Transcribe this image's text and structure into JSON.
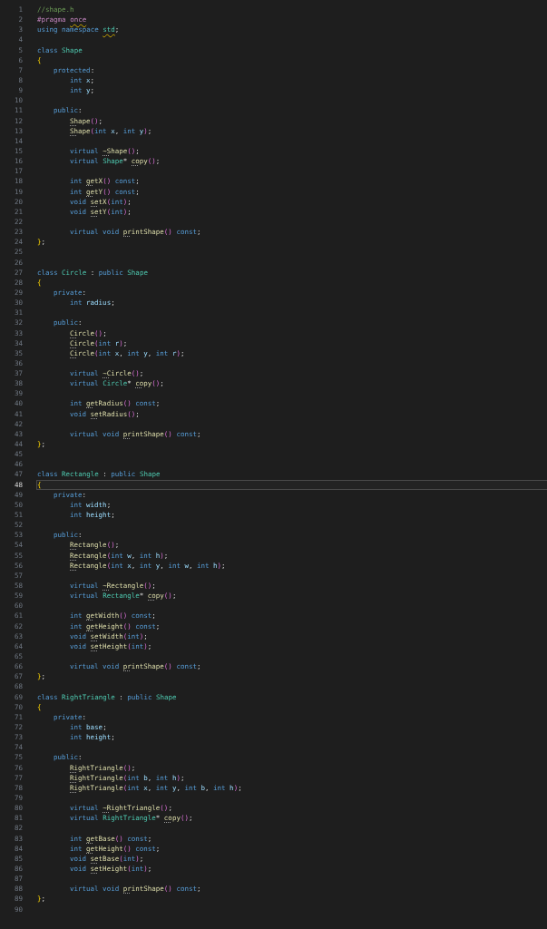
{
  "editor": {
    "lines": [
      {
        "number": "1",
        "current": false,
        "tokens": [
          {
            "text": "//shape.h",
            "kind": "cm"
          }
        ]
      },
      {
        "number": "2",
        "current": false,
        "tokens": [
          {
            "text": "#pragma ",
            "kind": "pp"
          },
          {
            "text": "once",
            "kind": "pp_warn"
          }
        ]
      },
      {
        "number": "3",
        "current": false,
        "tokens": [
          {
            "text": "using namespace ",
            "kind": "kw"
          },
          {
            "text": "std",
            "kind": "type_warn"
          },
          {
            "text": ";",
            "kind": "p"
          }
        ]
      },
      {
        "number": "4",
        "current": false
      },
      {
        "number": "5",
        "current": false,
        "tokens": [
          {
            "text": "class ",
            "kind": "kw"
          },
          {
            "text": "Shape",
            "kind": "type"
          }
        ]
      },
      {
        "number": "6",
        "current": false,
        "tokens": [
          {
            "text": "{",
            "kind": "b1"
          }
        ]
      },
      {
        "number": "7",
        "current": false,
        "kind": "access",
        "tokens": [
          {
            "text": "protected",
            "kind": "kw"
          },
          {
            "text": ":",
            "kind": "p"
          }
        ]
      },
      {
        "number": "8",
        "current": false,
        "kind": "member",
        "tokens": [
          {
            "text": "int ",
            "kind": "kw"
          },
          {
            "text": "x",
            "kind": "var"
          },
          {
            "text": ";",
            "kind": "p"
          }
        ]
      },
      {
        "number": "9",
        "current": false,
        "kind": "member",
        "tokens": [
          {
            "text": "int ",
            "kind": "kw"
          },
          {
            "text": "y",
            "kind": "var"
          },
          {
            "text": ";",
            "kind": "p"
          }
        ]
      },
      {
        "number": "10",
        "current": false
      },
      {
        "number": "11",
        "current": false,
        "kind": "access",
        "tokens": [
          {
            "text": "public",
            "kind": "kw"
          },
          {
            "text": ":",
            "kind": "p"
          }
        ]
      },
      {
        "number": "12",
        "current": false,
        "kind": "member",
        "tokens": [
          {
            "text": "Shape",
            "kind": "fn"
          },
          {
            "text": "()",
            "kind": "b2"
          },
          {
            "text": ";",
            "kind": "p"
          }
        ]
      },
      {
        "number": "13",
        "current": false,
        "kind": "member",
        "tokens": [
          {
            "text": "Shape",
            "kind": "fn"
          },
          {
            "text": "(",
            "kind": "b2"
          },
          {
            "text": "int ",
            "kind": "kw"
          },
          {
            "text": "x",
            "kind": "var"
          },
          {
            "text": ", ",
            "kind": "p"
          },
          {
            "text": "int ",
            "kind": "kw"
          },
          {
            "text": "y",
            "kind": "var"
          },
          {
            "text": ")",
            "kind": "b2"
          },
          {
            "text": ";",
            "kind": "p"
          }
        ]
      },
      {
        "number": "14",
        "current": false
      },
      {
        "number": "15",
        "current": false,
        "kind": "member",
        "tokens": [
          {
            "text": "virtual ",
            "kind": "kw"
          },
          {
            "text": "~Shape",
            "kind": "fn"
          },
          {
            "text": "()",
            "kind": "b2"
          },
          {
            "text": ";",
            "kind": "p"
          }
        ]
      },
      {
        "number": "16",
        "current": false,
        "kind": "member",
        "tokens": [
          {
            "text": "virtual ",
            "kind": "kw"
          },
          {
            "text": "Shape",
            "kind": "type"
          },
          {
            "text": "* ",
            "kind": "p"
          },
          {
            "text": "copy",
            "kind": "fn"
          },
          {
            "text": "()",
            "kind": "b2"
          },
          {
            "text": ";",
            "kind": "p"
          }
        ]
      },
      {
        "number": "17",
        "current": false
      },
      {
        "number": "18",
        "current": false,
        "kind": "member",
        "tokens": [
          {
            "text": "int ",
            "kind": "kw"
          },
          {
            "text": "getX",
            "kind": "fn"
          },
          {
            "text": "()",
            "kind": "b2"
          },
          {
            "text": " const",
            "kind": "kw"
          },
          {
            "text": ";",
            "kind": "p"
          }
        ]
      },
      {
        "number": "19",
        "current": false,
        "kind": "member",
        "tokens": [
          {
            "text": "int ",
            "kind": "kw"
          },
          {
            "text": "getY",
            "kind": "fn"
          },
          {
            "text": "()",
            "kind": "b2"
          },
          {
            "text": " const",
            "kind": "kw"
          },
          {
            "text": ";",
            "kind": "p"
          }
        ]
      },
      {
        "number": "20",
        "current": false,
        "kind": "member",
        "tokens": [
          {
            "text": "void ",
            "kind": "kw"
          },
          {
            "text": "setX",
            "kind": "fn"
          },
          {
            "text": "(",
            "kind": "b2"
          },
          {
            "text": "int",
            "kind": "kw"
          },
          {
            "text": ")",
            "kind": "b2"
          },
          {
            "text": ";",
            "kind": "p"
          }
        ]
      },
      {
        "number": "21",
        "current": false,
        "kind": "member",
        "tokens": [
          {
            "text": "void ",
            "kind": "kw"
          },
          {
            "text": "setY",
            "kind": "fn"
          },
          {
            "text": "(",
            "kind": "b2"
          },
          {
            "text": "int",
            "kind": "kw"
          },
          {
            "text": ")",
            "kind": "b2"
          },
          {
            "text": ";",
            "kind": "p"
          }
        ]
      },
      {
        "number": "22",
        "current": false
      },
      {
        "number": "23",
        "current": false,
        "kind": "member",
        "tokens": [
          {
            "text": "virtual void ",
            "kind": "kw"
          },
          {
            "text": "printShape",
            "kind": "fn"
          },
          {
            "text": "()",
            "kind": "b2"
          },
          {
            "text": " const",
            "kind": "kw"
          },
          {
            "text": ";",
            "kind": "p"
          }
        ]
      },
      {
        "number": "24",
        "current": false,
        "tokens": [
          {
            "text": "}",
            "kind": "b1"
          },
          {
            "text": ";",
            "kind": "p"
          }
        ]
      },
      {
        "number": "25",
        "current": false
      },
      {
        "number": "26",
        "current": false
      },
      {
        "number": "27",
        "current": false,
        "tokens": [
          {
            "text": "class ",
            "kind": "kw"
          },
          {
            "text": "Circle",
            "kind": "type"
          },
          {
            "text": " : ",
            "kind": "p"
          },
          {
            "text": "public ",
            "kind": "kw"
          },
          {
            "text": "Shape",
            "kind": "type"
          }
        ]
      },
      {
        "number": "28",
        "current": false,
        "tokens": [
          {
            "text": "{",
            "kind": "b1"
          }
        ]
      },
      {
        "number": "29",
        "current": false,
        "kind": "access",
        "tokens": [
          {
            "text": "private",
            "kind": "kw"
          },
          {
            "text": ":",
            "kind": "p"
          }
        ]
      },
      {
        "number": "30",
        "current": false,
        "kind": "member",
        "tokens": [
          {
            "text": "int ",
            "kind": "kw"
          },
          {
            "text": "radius",
            "kind": "var"
          },
          {
            "text": ";",
            "kind": "p"
          }
        ]
      },
      {
        "number": "31",
        "current": false
      },
      {
        "number": "32",
        "current": false,
        "kind": "access",
        "tokens": [
          {
            "text": "public",
            "kind": "kw"
          },
          {
            "text": ":",
            "kind": "p"
          }
        ]
      },
      {
        "number": "33",
        "current": false,
        "kind": "member",
        "tokens": [
          {
            "text": "Circle",
            "kind": "fn"
          },
          {
            "text": "()",
            "kind": "b2"
          },
          {
            "text": ";",
            "kind": "p"
          }
        ]
      },
      {
        "number": "34",
        "current": false,
        "kind": "member",
        "tokens": [
          {
            "text": "Circle",
            "kind": "fn"
          },
          {
            "text": "(",
            "kind": "b2"
          },
          {
            "text": "int ",
            "kind": "kw"
          },
          {
            "text": "r",
            "kind": "var"
          },
          {
            "text": ")",
            "kind": "b2"
          },
          {
            "text": ";",
            "kind": "p"
          }
        ]
      },
      {
        "number": "35",
        "current": false,
        "kind": "member",
        "tokens": [
          {
            "text": "Circle",
            "kind": "fn"
          },
          {
            "text": "(",
            "kind": "b2"
          },
          {
            "text": "int ",
            "kind": "kw"
          },
          {
            "text": "x",
            "kind": "var"
          },
          {
            "text": ", ",
            "kind": "p"
          },
          {
            "text": "int ",
            "kind": "kw"
          },
          {
            "text": "y",
            "kind": "var"
          },
          {
            "text": ", ",
            "kind": "p"
          },
          {
            "text": "int ",
            "kind": "kw"
          },
          {
            "text": "r",
            "kind": "var"
          },
          {
            "text": ")",
            "kind": "b2"
          },
          {
            "text": ";",
            "kind": "p"
          }
        ]
      },
      {
        "number": "36",
        "current": false
      },
      {
        "number": "37",
        "current": false,
        "kind": "member",
        "tokens": [
          {
            "text": "virtual ",
            "kind": "kw"
          },
          {
            "text": "~Circle",
            "kind": "fn"
          },
          {
            "text": "()",
            "kind": "b2"
          },
          {
            "text": ";",
            "kind": "p"
          }
        ]
      },
      {
        "number": "38",
        "current": false,
        "kind": "member",
        "tokens": [
          {
            "text": "virtual ",
            "kind": "kw"
          },
          {
            "text": "Circle",
            "kind": "type"
          },
          {
            "text": "* ",
            "kind": "p"
          },
          {
            "text": "copy",
            "kind": "fn"
          },
          {
            "text": "()",
            "kind": "b2"
          },
          {
            "text": ";",
            "kind": "p"
          }
        ]
      },
      {
        "number": "39",
        "current": false
      },
      {
        "number": "40",
        "current": false,
        "kind": "member",
        "tokens": [
          {
            "text": "int ",
            "kind": "kw"
          },
          {
            "text": "getRadius",
            "kind": "fn"
          },
          {
            "text": "()",
            "kind": "b2"
          },
          {
            "text": " const",
            "kind": "kw"
          },
          {
            "text": ";",
            "kind": "p"
          }
        ]
      },
      {
        "number": "41",
        "current": false,
        "kind": "member",
        "tokens": [
          {
            "text": "void ",
            "kind": "kw"
          },
          {
            "text": "setRadius",
            "kind": "fn"
          },
          {
            "text": "()",
            "kind": "b2"
          },
          {
            "text": ";",
            "kind": "p"
          }
        ]
      },
      {
        "number": "42",
        "current": false
      },
      {
        "number": "43",
        "current": false,
        "kind": "member",
        "tokens": [
          {
            "text": "virtual void ",
            "kind": "kw"
          },
          {
            "text": "printShape",
            "kind": "fn"
          },
          {
            "text": "()",
            "kind": "b2"
          },
          {
            "text": " const",
            "kind": "kw"
          },
          {
            "text": ";",
            "kind": "p"
          }
        ]
      },
      {
        "number": "44",
        "current": false,
        "tokens": [
          {
            "text": "}",
            "kind": "b1"
          },
          {
            "text": ";",
            "kind": "p"
          }
        ]
      },
      {
        "number": "45",
        "current": false
      },
      {
        "number": "46",
        "current": false
      },
      {
        "number": "47",
        "current": false,
        "tokens": [
          {
            "text": "class ",
            "kind": "kw"
          },
          {
            "text": "Rectangle",
            "kind": "type"
          },
          {
            "text": " : ",
            "kind": "p"
          },
          {
            "text": "public ",
            "kind": "kw"
          },
          {
            "text": "Shape",
            "kind": "type"
          }
        ]
      },
      {
        "number": "48",
        "current": true,
        "tokens": [
          {
            "text": "{",
            "kind": "b1"
          }
        ]
      },
      {
        "number": "49",
        "current": false,
        "kind": "access",
        "tokens": [
          {
            "text": "private",
            "kind": "kw"
          },
          {
            "text": ":",
            "kind": "p"
          }
        ]
      },
      {
        "number": "50",
        "current": false,
        "kind": "member",
        "tokens": [
          {
            "text": "int ",
            "kind": "kw"
          },
          {
            "text": "width",
            "kind": "var"
          },
          {
            "text": ";",
            "kind": "p"
          }
        ]
      },
      {
        "number": "51",
        "current": false,
        "kind": "member",
        "tokens": [
          {
            "text": "int ",
            "kind": "kw"
          },
          {
            "text": "height",
            "kind": "var"
          },
          {
            "text": ";",
            "kind": "p"
          }
        ]
      },
      {
        "number": "52",
        "current": false
      },
      {
        "number": "53",
        "current": false,
        "kind": "access",
        "tokens": [
          {
            "text": "public",
            "kind": "kw"
          },
          {
            "text": ":",
            "kind": "p"
          }
        ]
      },
      {
        "number": "54",
        "current": false,
        "kind": "member",
        "tokens": [
          {
            "text": "Rectangle",
            "kind": "fn"
          },
          {
            "text": "()",
            "kind": "b2"
          },
          {
            "text": ";",
            "kind": "p"
          }
        ]
      },
      {
        "number": "55",
        "current": false,
        "kind": "member",
        "tokens": [
          {
            "text": "Rectangle",
            "kind": "fn"
          },
          {
            "text": "(",
            "kind": "b2"
          },
          {
            "text": "int ",
            "kind": "kw"
          },
          {
            "text": "w",
            "kind": "var"
          },
          {
            "text": ", ",
            "kind": "p"
          },
          {
            "text": "int ",
            "kind": "kw"
          },
          {
            "text": "h",
            "kind": "var"
          },
          {
            "text": ")",
            "kind": "b2"
          },
          {
            "text": ";",
            "kind": "p"
          }
        ]
      },
      {
        "number": "56",
        "current": false,
        "kind": "member",
        "tokens": [
          {
            "text": "Rectangle",
            "kind": "fn"
          },
          {
            "text": "(",
            "kind": "b2"
          },
          {
            "text": "int ",
            "kind": "kw"
          },
          {
            "text": "x",
            "kind": "var"
          },
          {
            "text": ", ",
            "kind": "p"
          },
          {
            "text": "int ",
            "kind": "kw"
          },
          {
            "text": "y",
            "kind": "var"
          },
          {
            "text": ", ",
            "kind": "p"
          },
          {
            "text": "int ",
            "kind": "kw"
          },
          {
            "text": "w",
            "kind": "var"
          },
          {
            "text": ", ",
            "kind": "p"
          },
          {
            "text": "int ",
            "kind": "kw"
          },
          {
            "text": "h",
            "kind": "var"
          },
          {
            "text": ")",
            "kind": "b2"
          },
          {
            "text": ";",
            "kind": "p"
          }
        ]
      },
      {
        "number": "57",
        "current": false
      },
      {
        "number": "58",
        "current": false,
        "kind": "member",
        "tokens": [
          {
            "text": "virtual ",
            "kind": "kw"
          },
          {
            "text": "~Rectangle",
            "kind": "fn"
          },
          {
            "text": "()",
            "kind": "b2"
          },
          {
            "text": ";",
            "kind": "p"
          }
        ]
      },
      {
        "number": "59",
        "current": false,
        "kind": "member",
        "tokens": [
          {
            "text": "virtual ",
            "kind": "kw"
          },
          {
            "text": "Rectangle",
            "kind": "type"
          },
          {
            "text": "* ",
            "kind": "p"
          },
          {
            "text": "copy",
            "kind": "fn"
          },
          {
            "text": "()",
            "kind": "b2"
          },
          {
            "text": ";",
            "kind": "p"
          }
        ]
      },
      {
        "number": "60",
        "current": false
      },
      {
        "number": "61",
        "current": false,
        "kind": "member",
        "tokens": [
          {
            "text": "int ",
            "kind": "kw"
          },
          {
            "text": "getWidth",
            "kind": "fn"
          },
          {
            "text": "()",
            "kind": "b2"
          },
          {
            "text": " const",
            "kind": "kw"
          },
          {
            "text": ";",
            "kind": "p"
          }
        ]
      },
      {
        "number": "62",
        "current": false,
        "kind": "member",
        "tokens": [
          {
            "text": "int ",
            "kind": "kw"
          },
          {
            "text": "getHeight",
            "kind": "fn"
          },
          {
            "text": "()",
            "kind": "b2"
          },
          {
            "text": " const",
            "kind": "kw"
          },
          {
            "text": ";",
            "kind": "p"
          }
        ]
      },
      {
        "number": "63",
        "current": false,
        "kind": "member",
        "tokens": [
          {
            "text": "void ",
            "kind": "kw"
          },
          {
            "text": "setWidth",
            "kind": "fn"
          },
          {
            "text": "(",
            "kind": "b2"
          },
          {
            "text": "int",
            "kind": "kw"
          },
          {
            "text": ")",
            "kind": "b2"
          },
          {
            "text": ";",
            "kind": "p"
          }
        ]
      },
      {
        "number": "64",
        "current": false,
        "kind": "member",
        "tokens": [
          {
            "text": "void ",
            "kind": "kw"
          },
          {
            "text": "setHeight",
            "kind": "fn"
          },
          {
            "text": "(",
            "kind": "b2"
          },
          {
            "text": "int",
            "kind": "kw"
          },
          {
            "text": ")",
            "kind": "b2"
          },
          {
            "text": ";",
            "kind": "p"
          }
        ]
      },
      {
        "number": "65",
        "current": false
      },
      {
        "number": "66",
        "current": false,
        "kind": "member",
        "tokens": [
          {
            "text": "virtual void ",
            "kind": "kw"
          },
          {
            "text": "printShape",
            "kind": "fn"
          },
          {
            "text": "()",
            "kind": "b2"
          },
          {
            "text": " const",
            "kind": "kw"
          },
          {
            "text": ";",
            "kind": "p"
          }
        ]
      },
      {
        "number": "67",
        "current": false,
        "tokens": [
          {
            "text": "}",
            "kind": "b1"
          },
          {
            "text": ";",
            "kind": "p"
          }
        ]
      },
      {
        "number": "68",
        "current": false
      },
      {
        "number": "69",
        "current": false,
        "tokens": [
          {
            "text": "class ",
            "kind": "kw"
          },
          {
            "text": "RightTriangle",
            "kind": "type"
          },
          {
            "text": " : ",
            "kind": "p"
          },
          {
            "text": "public ",
            "kind": "kw"
          },
          {
            "text": "Shape",
            "kind": "type"
          }
        ]
      },
      {
        "number": "70",
        "current": false,
        "tokens": [
          {
            "text": "{",
            "kind": "b1"
          }
        ]
      },
      {
        "number": "71",
        "current": false,
        "kind": "access",
        "tokens": [
          {
            "text": "private",
            "kind": "kw"
          },
          {
            "text": ":",
            "kind": "p"
          }
        ]
      },
      {
        "number": "72",
        "current": false,
        "kind": "member",
        "tokens": [
          {
            "text": "int ",
            "kind": "kw"
          },
          {
            "text": "base",
            "kind": "var"
          },
          {
            "text": ";",
            "kind": "p"
          }
        ]
      },
      {
        "number": "73",
        "current": false,
        "kind": "member",
        "tokens": [
          {
            "text": "int ",
            "kind": "kw"
          },
          {
            "text": "height",
            "kind": "var"
          },
          {
            "text": ";",
            "kind": "p"
          }
        ]
      },
      {
        "number": "74",
        "current": false
      },
      {
        "number": "75",
        "current": false,
        "kind": "access",
        "tokens": [
          {
            "text": "public",
            "kind": "kw"
          },
          {
            "text": ":",
            "kind": "p"
          }
        ]
      },
      {
        "number": "76",
        "current": false,
        "kind": "member",
        "tokens": [
          {
            "text": "RightTriangle",
            "kind": "fn"
          },
          {
            "text": "()",
            "kind": "b2"
          },
          {
            "text": ";",
            "kind": "p"
          }
        ]
      },
      {
        "number": "77",
        "current": false,
        "kind": "member",
        "tokens": [
          {
            "text": "RightTriangle",
            "kind": "fn"
          },
          {
            "text": "(",
            "kind": "b2"
          },
          {
            "text": "int ",
            "kind": "kw"
          },
          {
            "text": "b",
            "kind": "var"
          },
          {
            "text": ", ",
            "kind": "p"
          },
          {
            "text": "int ",
            "kind": "kw"
          },
          {
            "text": "h",
            "kind": "var"
          },
          {
            "text": ")",
            "kind": "b2"
          },
          {
            "text": ";",
            "kind": "p"
          }
        ]
      },
      {
        "number": "78",
        "current": false,
        "kind": "member",
        "tokens": [
          {
            "text": "RightTriangle",
            "kind": "fn"
          },
          {
            "text": "(",
            "kind": "b2"
          },
          {
            "text": "int ",
            "kind": "kw"
          },
          {
            "text": "x",
            "kind": "var"
          },
          {
            "text": ", ",
            "kind": "p"
          },
          {
            "text": "int ",
            "kind": "kw"
          },
          {
            "text": "y",
            "kind": "var"
          },
          {
            "text": ", ",
            "kind": "p"
          },
          {
            "text": "int ",
            "kind": "kw"
          },
          {
            "text": "b",
            "kind": "var"
          },
          {
            "text": ", ",
            "kind": "p"
          },
          {
            "text": "int ",
            "kind": "kw"
          },
          {
            "text": "h",
            "kind": "var"
          },
          {
            "text": ")",
            "kind": "b2"
          },
          {
            "text": ";",
            "kind": "p"
          }
        ]
      },
      {
        "number": "79",
        "current": false
      },
      {
        "number": "80",
        "current": false,
        "kind": "member",
        "tokens": [
          {
            "text": "virtual ",
            "kind": "kw"
          },
          {
            "text": "~RightTriangle",
            "kind": "fn"
          },
          {
            "text": "()",
            "kind": "b2"
          },
          {
            "text": ";",
            "kind": "p"
          }
        ]
      },
      {
        "number": "81",
        "current": false,
        "kind": "member",
        "tokens": [
          {
            "text": "virtual ",
            "kind": "kw"
          },
          {
            "text": "RightTriangle",
            "kind": "type"
          },
          {
            "text": "* ",
            "kind": "p"
          },
          {
            "text": "copy",
            "kind": "fn"
          },
          {
            "text": "()",
            "kind": "b2"
          },
          {
            "text": ";",
            "kind": "p"
          }
        ]
      },
      {
        "number": "82",
        "current": false
      },
      {
        "number": "83",
        "current": false,
        "kind": "member",
        "tokens": [
          {
            "text": "int ",
            "kind": "kw"
          },
          {
            "text": "getBase",
            "kind": "fn"
          },
          {
            "text": "()",
            "kind": "b2"
          },
          {
            "text": " const",
            "kind": "kw"
          },
          {
            "text": ";",
            "kind": "p"
          }
        ]
      },
      {
        "number": "84",
        "current": false,
        "kind": "member",
        "tokens": [
          {
            "text": "int ",
            "kind": "kw"
          },
          {
            "text": "getHeight",
            "kind": "fn"
          },
          {
            "text": "()",
            "kind": "b2"
          },
          {
            "text": " const",
            "kind": "kw"
          },
          {
            "text": ";",
            "kind": "p"
          }
        ]
      },
      {
        "number": "85",
        "current": false,
        "kind": "member",
        "tokens": [
          {
            "text": "void ",
            "kind": "kw"
          },
          {
            "text": "setBase",
            "kind": "fn"
          },
          {
            "text": "(",
            "kind": "b2"
          },
          {
            "text": "int",
            "kind": "kw"
          },
          {
            "text": ")",
            "kind": "b2"
          },
          {
            "text": ";",
            "kind": "p"
          }
        ]
      },
      {
        "number": "86",
        "current": false,
        "kind": "member",
        "tokens": [
          {
            "text": "void ",
            "kind": "kw"
          },
          {
            "text": "setHeight",
            "kind": "fn"
          },
          {
            "text": "(",
            "kind": "b2"
          },
          {
            "text": "int",
            "kind": "kw"
          },
          {
            "text": ")",
            "kind": "b2"
          },
          {
            "text": ";",
            "kind": "p"
          }
        ]
      },
      {
        "number": "87",
        "current": false
      },
      {
        "number": "88",
        "current": false,
        "kind": "member",
        "tokens": [
          {
            "text": "virtual void ",
            "kind": "kw"
          },
          {
            "text": "printShape",
            "kind": "fn"
          },
          {
            "text": "()",
            "kind": "b2"
          },
          {
            "text": " const",
            "kind": "kw"
          },
          {
            "text": ";",
            "kind": "p"
          }
        ]
      },
      {
        "number": "89",
        "current": false,
        "tokens": [
          {
            "text": "}",
            "kind": "b1"
          },
          {
            "text": ";",
            "kind": "p"
          }
        ]
      },
      {
        "number": "90",
        "current": false
      }
    ]
  }
}
